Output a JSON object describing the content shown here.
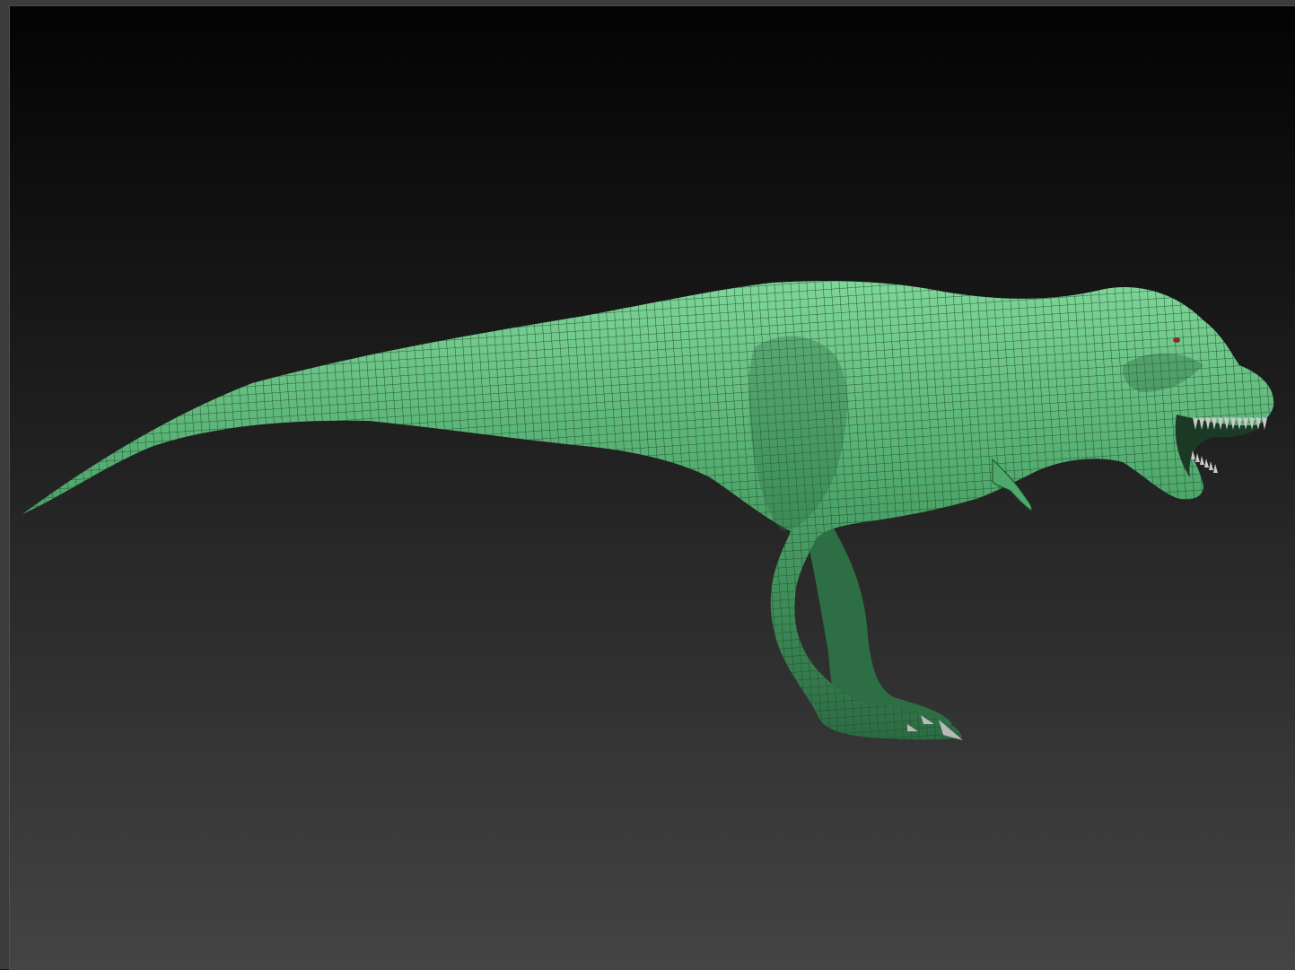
{
  "viewport": {
    "background_top_color": "#030303",
    "background_bottom_color": "#444444",
    "frame_color": "#3c3c3c"
  },
  "model": {
    "icon": "t-rex-mesh-icon",
    "base_color": "#4fa86c",
    "highlight_color": "#7fd699",
    "shadow_color": "#2c6b42",
    "wireframe_color": "#1f4a2c",
    "teeth_color": "#c9c9c9",
    "claw_color": "#b9b9b9"
  }
}
